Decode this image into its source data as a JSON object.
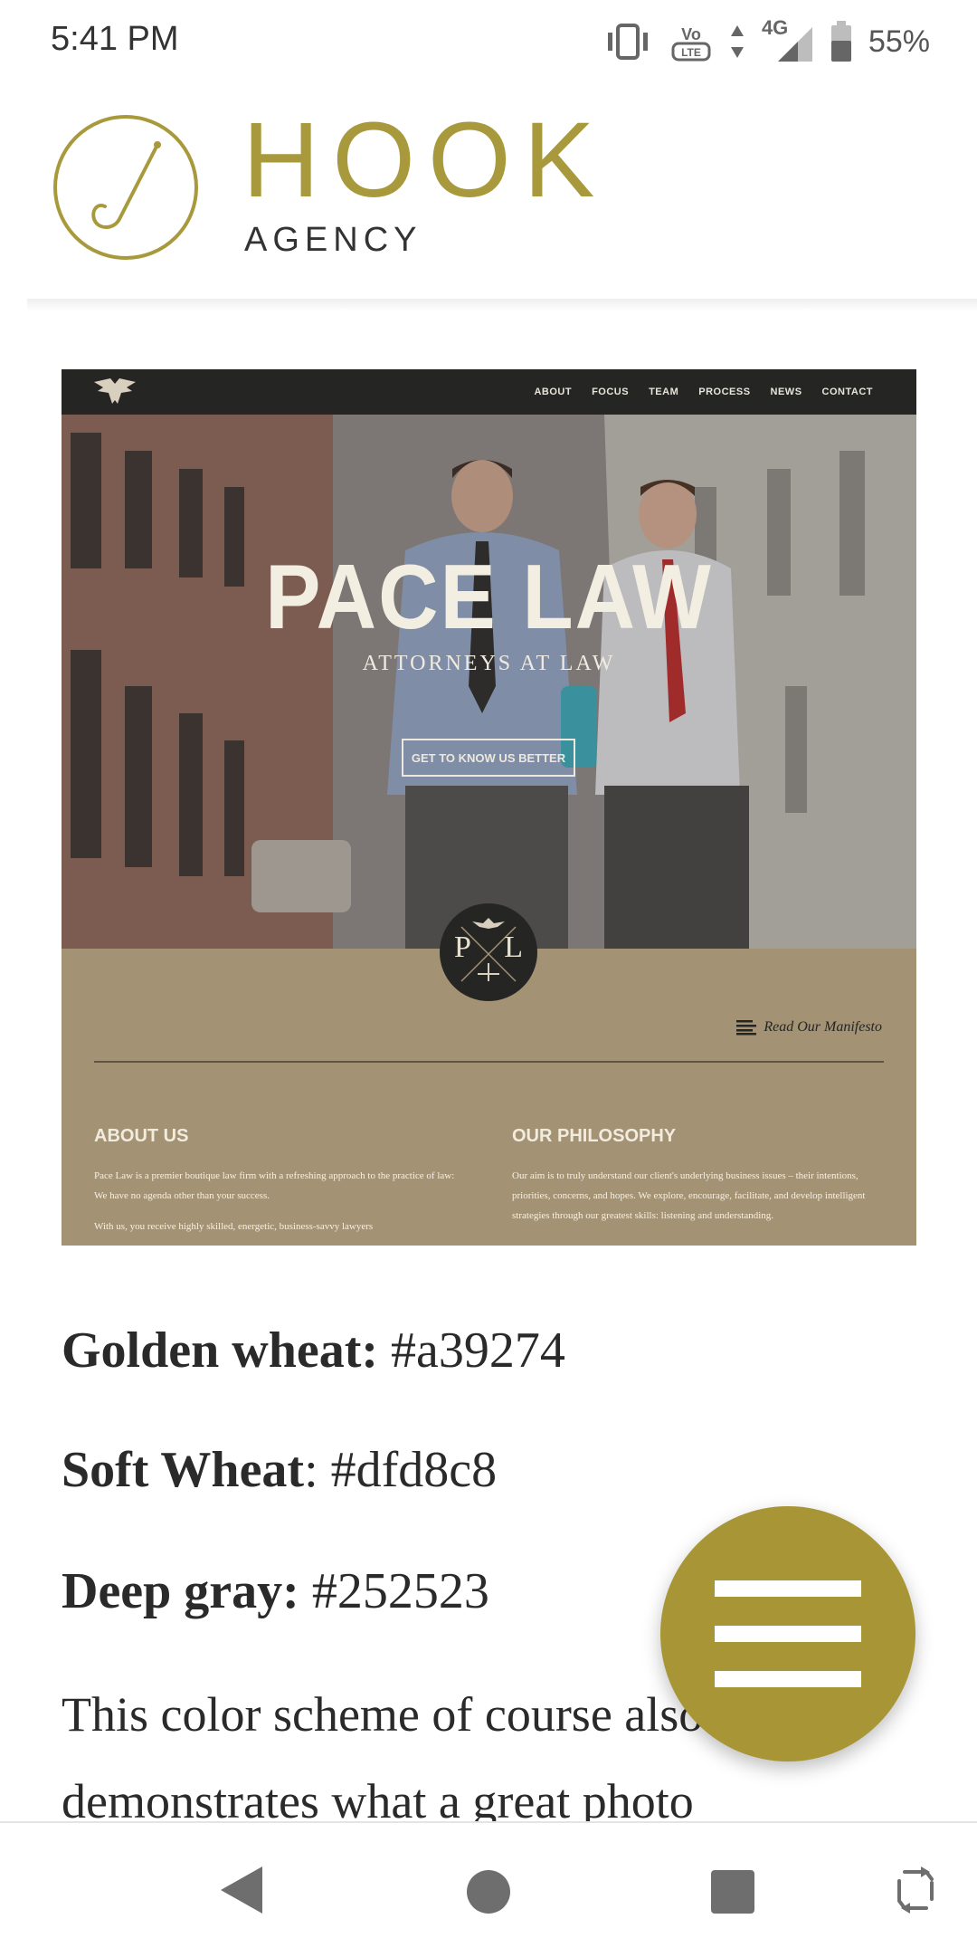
{
  "status_bar": {
    "time": "5:41 PM",
    "network": "4G",
    "volte": "VoLTE",
    "battery": "55%",
    "icons": [
      "vibrate-icon",
      "volte-icon",
      "data-arrows-icon",
      "signal-icon",
      "battery-icon"
    ]
  },
  "header": {
    "logo_word": "HOOK",
    "logo_sub": "AGENCY",
    "brand_color": "#a89a3c"
  },
  "preview": {
    "nav": [
      "ABOUT",
      "FOCUS",
      "TEAM",
      "PROCESS",
      "NEWS",
      "CONTACT"
    ],
    "hero_title": "PACE LAW",
    "hero_subtitle": "ATTORNEYS AT LAW",
    "cta": "GET TO KNOW US BETTER",
    "badge_left": "P",
    "badge_right": "L",
    "manifesto": "Read Our Manifesto",
    "about_title": "ABOUT US",
    "about_text_1": "Pace Law is a premier boutique law firm with a refreshing approach to the practice of law: We have no agenda other than your success.",
    "about_text_2": "With us, you receive highly skilled, energetic, business-savvy lawyers",
    "philosophy_title": "OUR PHILOSOPHY",
    "philosophy_text": "Our aim is to truly understand our client's underlying business issues – their intentions, priorities, concerns, and hopes. We explore, encourage, facilitate, and develop intelligent strategies through our greatest skills: listening and understanding.",
    "colors": {
      "dark": "#252523",
      "tan": "#a39274",
      "cream": "#dfd8c8"
    }
  },
  "article": {
    "colors": [
      {
        "name": "Golden wheat:",
        "value": " #a39274"
      },
      {
        "name": "Soft Wheat",
        "value": ": #dfd8c8"
      },
      {
        "name": "Deep gray:",
        "value": " #252523"
      }
    ],
    "paragraph": "This color scheme of course also demonstrates what a great photo"
  },
  "fab": {
    "icon": "menu-icon",
    "color": "#a89536"
  },
  "nav_bar": {
    "icons": [
      "back-icon",
      "home-icon",
      "recents-icon",
      "rotate-icon"
    ]
  }
}
